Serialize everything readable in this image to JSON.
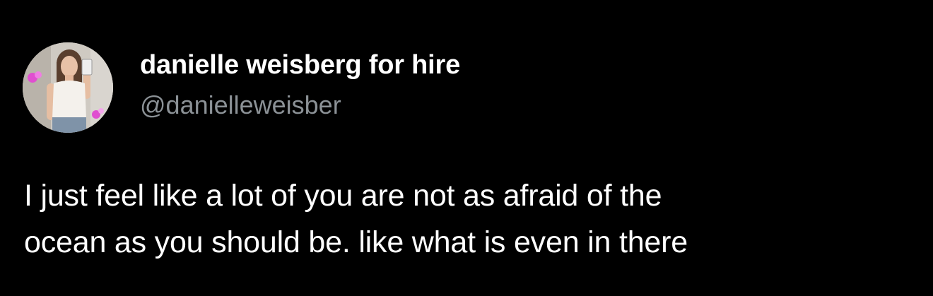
{
  "author": {
    "display_name": "danielle weisberg for hire",
    "handle": "@danielleweisber",
    "avatar_icon": "profile-photo"
  },
  "tweet": {
    "lines": [
      "I just feel like a lot of you are not as afraid of the",
      "ocean as you should be. like what is even in there"
    ]
  },
  "colors": {
    "background": "#000000",
    "text_primary": "#ffffff",
    "text_secondary": "#8b9196"
  }
}
